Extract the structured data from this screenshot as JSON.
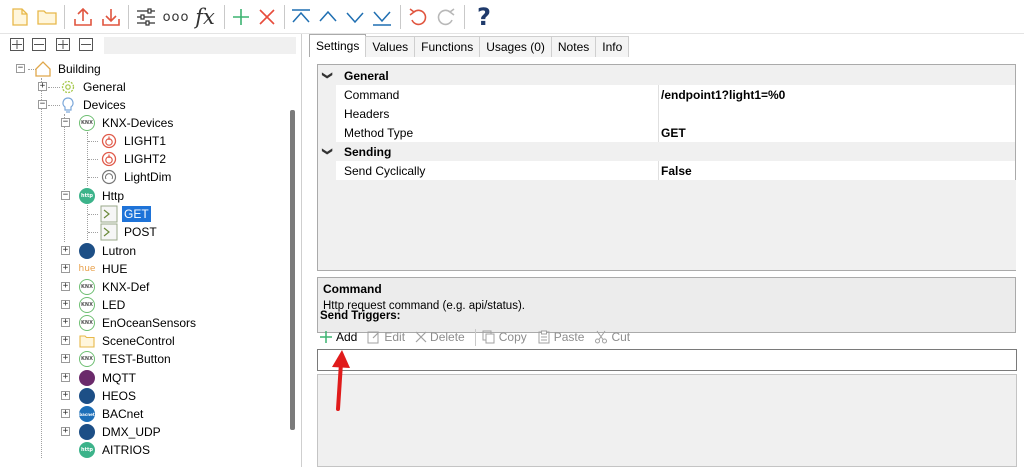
{
  "toolbar": {
    "icons": [
      "new-icon",
      "open-folder-icon",
      "upload-icon",
      "download-icon",
      "settings-sliders-icon",
      "more-icon",
      "function-icon",
      "add-icon",
      "delete-icon",
      "move-top-icon",
      "move-up-icon",
      "move-down-icon",
      "move-bottom-icon",
      "undo-icon",
      "redo-icon",
      "help-icon"
    ],
    "more_glyph": "ooo",
    "fx_glyph": "fx",
    "help_glyph": "?"
  },
  "tree": {
    "nodes": [
      {
        "label": "Building",
        "icon": "house-icon"
      },
      {
        "label": "General",
        "icon": "gear-icon"
      },
      {
        "label": "Devices",
        "icon": "lightbulb-icon"
      },
      {
        "label": "KNX-Devices",
        "icon": "knx-badge-icon",
        "badge": "KNX"
      },
      {
        "label": "LIGHT1",
        "icon": "power-icon"
      },
      {
        "label": "LIGHT2",
        "icon": "power-icon"
      },
      {
        "label": "LightDim",
        "icon": "dimmer-icon"
      },
      {
        "label": "Http",
        "icon": "http-badge-icon",
        "badge": "http"
      },
      {
        "label": "GET",
        "icon": "terminal-icon",
        "selected": true
      },
      {
        "label": "POST",
        "icon": "terminal-icon"
      },
      {
        "label": "Lutron",
        "icon": "lutron-icon"
      },
      {
        "label": "HUE",
        "icon": "hue-icon",
        "badge": "hue"
      },
      {
        "label": "KNX-Def",
        "icon": "knx-badge-icon",
        "badge": "KNX"
      },
      {
        "label": "LED",
        "icon": "knx-badge-icon",
        "badge": "KNX"
      },
      {
        "label": "EnOceanSensors",
        "icon": "knx-badge-icon",
        "badge": "KNX"
      },
      {
        "label": "SceneControl",
        "icon": "folder-icon"
      },
      {
        "label": "TEST-Button",
        "icon": "knx-badge-icon",
        "badge": "KNX"
      },
      {
        "label": "MQTT",
        "icon": "mqtt-icon"
      },
      {
        "label": "HEOS",
        "icon": "heos-icon"
      },
      {
        "label": "BACnet",
        "icon": "bacnet-icon",
        "badge": "bacnet"
      },
      {
        "label": "DMX_UDP",
        "icon": "dmx-icon"
      },
      {
        "label": "AITRIOS",
        "icon": "http-badge-icon",
        "badge": "http"
      }
    ]
  },
  "tabs": [
    {
      "label": "Settings",
      "active": true
    },
    {
      "label": "Values"
    },
    {
      "label": "Functions"
    },
    {
      "label": "Usages (0)"
    },
    {
      "label": "Notes"
    },
    {
      "label": "Info"
    }
  ],
  "properties": {
    "general_label": "General",
    "command_name": "Command",
    "command_value": "/endpoint1?light1=%0",
    "headers_name": "Headers",
    "headers_value": "",
    "method_name": "Method Type",
    "method_value": "GET",
    "sending_label": "Sending",
    "cyclic_name": "Send Cyclically",
    "cyclic_value": "False"
  },
  "description": {
    "title": "Command",
    "text": "Http request command (e.g. api/status)."
  },
  "triggers": {
    "label": "Send Triggers:",
    "add": "Add",
    "edit": "Edit",
    "delete": "Delete",
    "copy": "Copy",
    "paste": "Paste",
    "cut": "Cut"
  },
  "colors": {
    "accent_red": "#e74c3c",
    "accent_green": "#3cb371",
    "toolbar_blue": "#1f6fb2",
    "selection": "#1e73d8",
    "annotation_arrow": "#e01b1b"
  }
}
